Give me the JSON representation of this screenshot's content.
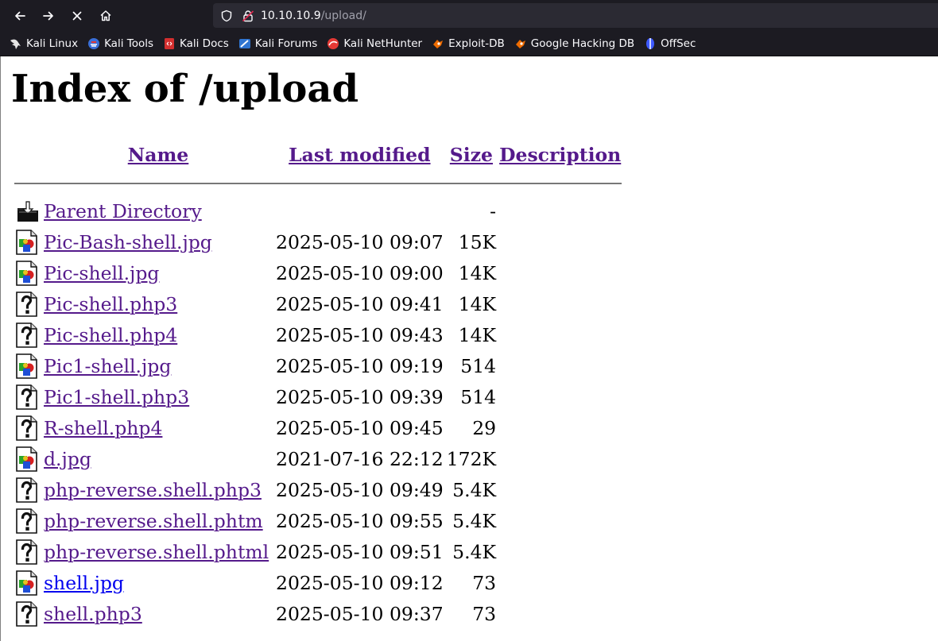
{
  "browser": {
    "url_host": "10.10.10.9",
    "url_path": "/upload/",
    "bookmarks": [
      {
        "label": "Kali Linux",
        "icon": "kali-dragon-icon",
        "color": "#e6e6e6"
      },
      {
        "label": "Kali Tools",
        "icon": "kali-tools-icon",
        "color": "#3a6fd8"
      },
      {
        "label": "Kali Docs",
        "icon": "kali-docs-icon",
        "color": "#d32f2f"
      },
      {
        "label": "Kali Forums",
        "icon": "kali-forums-icon",
        "color": "#2f74d0"
      },
      {
        "label": "Kali NetHunter",
        "icon": "kali-nethunter-icon",
        "color": "#e53935"
      },
      {
        "label": "Exploit-DB",
        "icon": "exploit-db-icon",
        "color": "#ef6c00"
      },
      {
        "label": "Google Hacking DB",
        "icon": "ghdb-icon",
        "color": "#ef6c00"
      },
      {
        "label": "OffSec",
        "icon": "offsec-icon",
        "color": "#3d5afe"
      }
    ]
  },
  "page": {
    "title": "Index of /upload",
    "columns": {
      "name": "Name",
      "last_modified": "Last modified",
      "size": "Size",
      "description": "Description"
    },
    "rows": [
      {
        "icon": "parent-directory-icon",
        "name": "Parent Directory",
        "date": "",
        "size": "-",
        "visited": true
      },
      {
        "icon": "image-file-icon",
        "name": "Pic-Bash-shell.jpg",
        "date": "2025-05-10 09:07",
        "size": "15K",
        "visited": true
      },
      {
        "icon": "image-file-icon",
        "name": "Pic-shell.jpg",
        "date": "2025-05-10 09:00",
        "size": "14K",
        "visited": true
      },
      {
        "icon": "unknown-file-icon",
        "name": "Pic-shell.php3",
        "date": "2025-05-10 09:41",
        "size": "14K",
        "visited": true
      },
      {
        "icon": "unknown-file-icon",
        "name": "Pic-shell.php4",
        "date": "2025-05-10 09:43",
        "size": "14K",
        "visited": true
      },
      {
        "icon": "image-file-icon",
        "name": "Pic1-shell.jpg",
        "date": "2025-05-10 09:19",
        "size": "514",
        "visited": true
      },
      {
        "icon": "unknown-file-icon",
        "name": "Pic1-shell.php3",
        "date": "2025-05-10 09:39",
        "size": "514",
        "visited": true
      },
      {
        "icon": "unknown-file-icon",
        "name": "R-shell.php4",
        "date": "2025-05-10 09:45",
        "size": "29",
        "visited": true
      },
      {
        "icon": "image-file-icon",
        "name": "d.jpg",
        "date": "2021-07-16 22:12",
        "size": "172K",
        "visited": true
      },
      {
        "icon": "unknown-file-icon",
        "name": "php-reverse.shell.php3",
        "date": "2025-05-10 09:49",
        "size": "5.4K",
        "visited": true
      },
      {
        "icon": "unknown-file-icon",
        "name": "php-reverse.shell.phtm",
        "date": "2025-05-10 09:55",
        "size": "5.4K",
        "visited": true
      },
      {
        "icon": "unknown-file-icon",
        "name": "php-reverse.shell.phtml",
        "date": "2025-05-10 09:51",
        "size": "5.4K",
        "visited": true
      },
      {
        "icon": "image-file-icon",
        "name": "shell.jpg",
        "date": "2025-05-10 09:12",
        "size": "73",
        "visited": false
      },
      {
        "icon": "unknown-file-icon",
        "name": "shell.php3",
        "date": "2025-05-10 09:37",
        "size": "73",
        "visited": true
      }
    ]
  }
}
